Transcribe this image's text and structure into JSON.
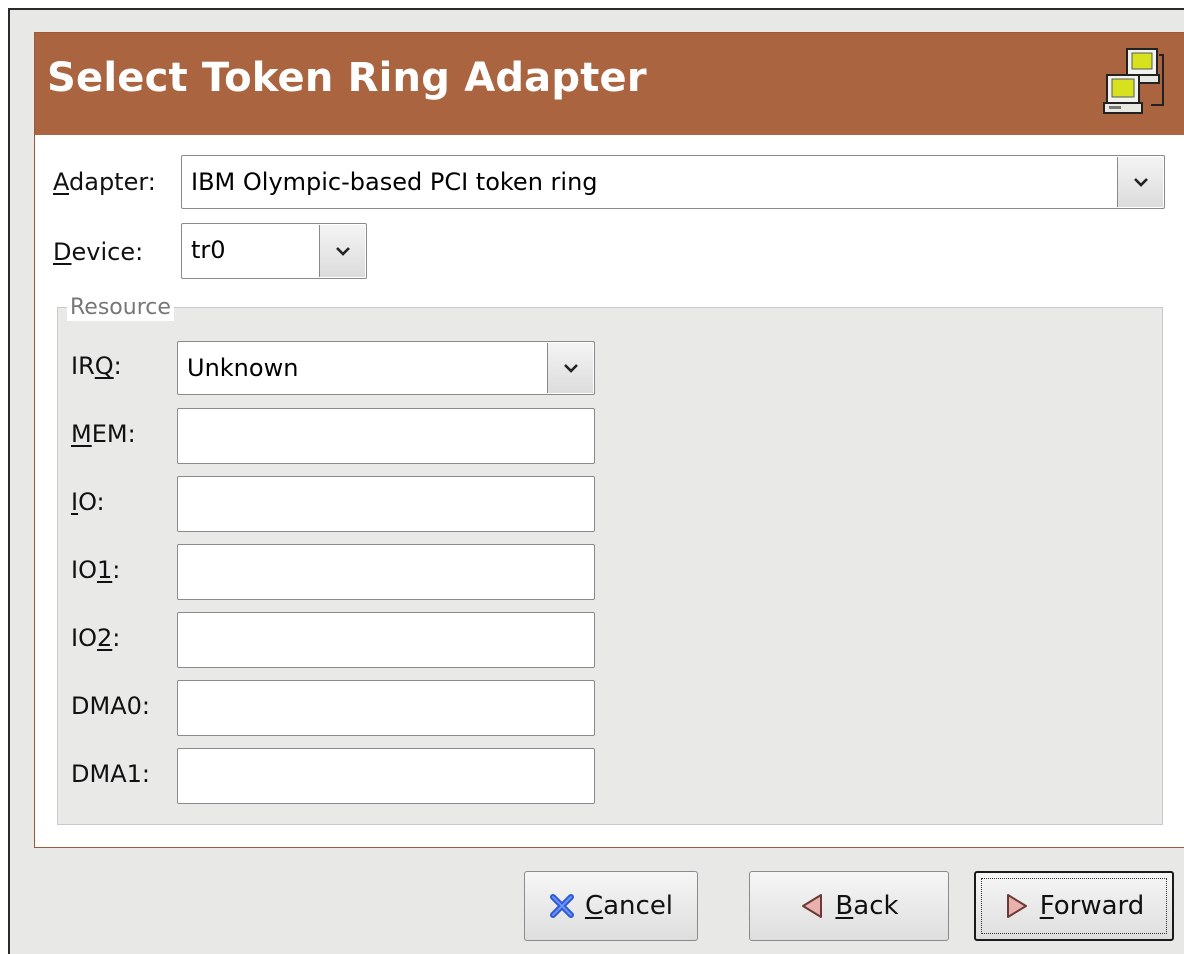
{
  "header": {
    "title": "Select Token Ring Adapter",
    "icon": "network-computers-icon",
    "background": "#ab6440"
  },
  "adapter": {
    "label_mnemonic": "A",
    "label_rest": "dapter:",
    "value": "IBM Olympic-based PCI token ring"
  },
  "device": {
    "label_mnemonic": "D",
    "label_rest": "evice:",
    "value": "tr0"
  },
  "resource": {
    "legend": "Resource",
    "irq": {
      "label_pre": "IR",
      "label_mnemonic": "Q",
      "label_post": ":",
      "value": "Unknown"
    },
    "mem": {
      "label_mnemonic": "M",
      "label_rest": "EM:",
      "value": ""
    },
    "io": {
      "label_mnemonic": "I",
      "label_rest": "O:",
      "value": ""
    },
    "io1": {
      "label_pre": "IO",
      "label_mnemonic": "1",
      "label_post": ":",
      "value": ""
    },
    "io2": {
      "label_pre": "IO",
      "label_mnemonic": "2",
      "label_post": ":",
      "value": ""
    },
    "dma0": {
      "label": "DMA0:",
      "value": ""
    },
    "dma1": {
      "label": "DMA1:",
      "value": ""
    }
  },
  "buttons": {
    "cancel": {
      "mnemonic": "C",
      "rest": "ancel",
      "icon": "close-x-icon"
    },
    "back": {
      "mnemonic": "B",
      "rest": "ack",
      "icon": "back-arrow-icon"
    },
    "forward": {
      "mnemonic": "F",
      "rest": "orward",
      "icon": "forward-arrow-icon"
    }
  }
}
